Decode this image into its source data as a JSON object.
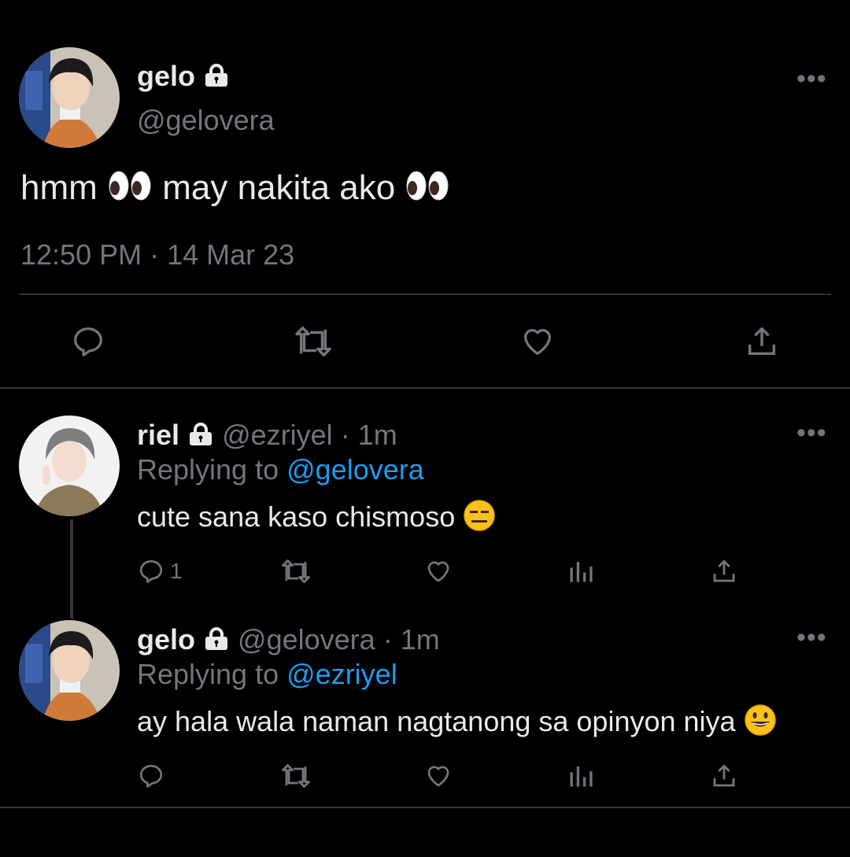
{
  "main_tweet": {
    "display_name": "gelo",
    "handle": "@gelovera",
    "text_before": "hmm",
    "text_middle": "may nakita ako",
    "emoji": "eyes",
    "timestamp": "12:50 PM · 14 Mar 23"
  },
  "replies": [
    {
      "display_name": "riel",
      "handle": "@ezriyel",
      "sep": "·",
      "time": "1m",
      "replying_prefix": "Replying to",
      "replying_handle": "@gelovera",
      "text": "cute sana kaso chismoso",
      "emoji": "expressionless-face",
      "reply_count": "1"
    },
    {
      "display_name": "gelo",
      "handle": "@gelovera",
      "sep": "·",
      "time": "1m",
      "replying_prefix": "Replying to",
      "replying_handle": "@ezriyel",
      "text": "ay hala wala naman nagtanong sa opinyon niya",
      "emoji": "grinning-face",
      "reply_count": ""
    }
  ],
  "colors": {
    "background": "#000000",
    "text": "#e7e9ea",
    "muted": "#71767b",
    "link": "#1d9bf0",
    "divider": "#2f3336"
  }
}
